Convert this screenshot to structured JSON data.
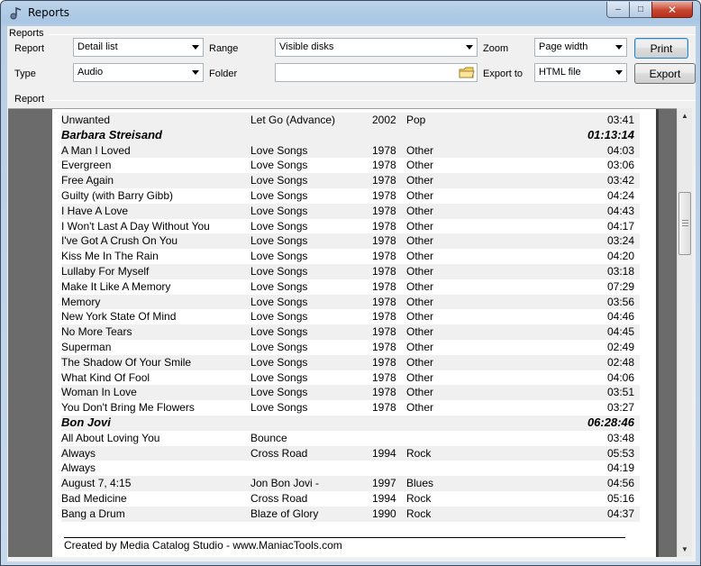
{
  "window": {
    "title": "Reports",
    "minimize_glyph": "–",
    "maximize_glyph": "□",
    "close_glyph": "✕"
  },
  "reports_group": {
    "label": "Reports",
    "report_label": "Report",
    "report_value": "Detail list",
    "type_label": "Type",
    "type_value": "Audio",
    "range_label": "Range",
    "range_value": "Visible disks",
    "folder_label": "Folder",
    "folder_value": "",
    "zoom_label": "Zoom",
    "zoom_value": "Page width",
    "export_to_label": "Export to",
    "export_to_value": "HTML file",
    "print_button": "Print",
    "export_button": "Export"
  },
  "report_group": {
    "label": "Report"
  },
  "report": {
    "rows": [
      {
        "kind": "track",
        "title": "Unwanted",
        "album": "Let Go (Advance)",
        "year": "2002",
        "genre": "Pop",
        "length": "03:41"
      },
      {
        "kind": "group",
        "title": "Barbara Streisand",
        "length": "01:13:14"
      },
      {
        "kind": "track",
        "title": "A Man I Loved",
        "album": "Love Songs",
        "year": "1978",
        "genre": "Other",
        "length": "04:03"
      },
      {
        "kind": "track",
        "title": "Evergreen",
        "album": "Love Songs",
        "year": "1978",
        "genre": "Other",
        "length": "03:06"
      },
      {
        "kind": "track",
        "title": "Free Again",
        "album": "Love Songs",
        "year": "1978",
        "genre": "Other",
        "length": "03:42"
      },
      {
        "kind": "track",
        "title": "Guilty (with Barry Gibb)",
        "album": "Love Songs",
        "year": "1978",
        "genre": "Other",
        "length": "04:24"
      },
      {
        "kind": "track",
        "title": "I Have A Love",
        "album": "Love Songs",
        "year": "1978",
        "genre": "Other",
        "length": "04:43"
      },
      {
        "kind": "track",
        "title": "I Won't Last A Day Without You",
        "album": "Love Songs",
        "year": "1978",
        "genre": "Other",
        "length": "04:17"
      },
      {
        "kind": "track",
        "title": "I've Got A Crush On You",
        "album": "Love Songs",
        "year": "1978",
        "genre": "Other",
        "length": "03:24"
      },
      {
        "kind": "track",
        "title": "Kiss Me In The Rain",
        "album": "Love Songs",
        "year": "1978",
        "genre": "Other",
        "length": "04:20"
      },
      {
        "kind": "track",
        "title": "Lullaby For Myself",
        "album": "Love Songs",
        "year": "1978",
        "genre": "Other",
        "length": "03:18"
      },
      {
        "kind": "track",
        "title": "Make It Like A Memory",
        "album": "Love Songs",
        "year": "1978",
        "genre": "Other",
        "length": "07:29"
      },
      {
        "kind": "track",
        "title": "Memory",
        "album": "Love Songs",
        "year": "1978",
        "genre": "Other",
        "length": "03:56"
      },
      {
        "kind": "track",
        "title": "New York State Of Mind",
        "album": "Love Songs",
        "year": "1978",
        "genre": "Other",
        "length": "04:46"
      },
      {
        "kind": "track",
        "title": "No More Tears",
        "album": "Love Songs",
        "year": "1978",
        "genre": "Other",
        "length": "04:45"
      },
      {
        "kind": "track",
        "title": "Superman",
        "album": "Love Songs",
        "year": "1978",
        "genre": "Other",
        "length": "02:49"
      },
      {
        "kind": "track",
        "title": "The Shadow Of Your Smile",
        "album": "Love Songs",
        "year": "1978",
        "genre": "Other",
        "length": "02:48"
      },
      {
        "kind": "track",
        "title": "What Kind Of Fool",
        "album": "Love Songs",
        "year": "1978",
        "genre": "Other",
        "length": "04:06"
      },
      {
        "kind": "track",
        "title": "Woman In Love",
        "album": "Love Songs",
        "year": "1978",
        "genre": "Other",
        "length": "03:51"
      },
      {
        "kind": "track",
        "title": "You Don't Bring Me Flowers",
        "album": "Love Songs",
        "year": "1978",
        "genre": "Other",
        "length": "03:27"
      },
      {
        "kind": "group",
        "title": "Bon Jovi",
        "length": "06:28:46"
      },
      {
        "kind": "track",
        "title": "All About Loving You",
        "album": "Bounce",
        "year": "",
        "genre": "",
        "length": "03:48"
      },
      {
        "kind": "track",
        "title": "Always",
        "album": "Cross Road",
        "year": "1994",
        "genre": "Rock",
        "length": "05:53"
      },
      {
        "kind": "track",
        "title": "Always",
        "album": "",
        "year": "",
        "genre": "",
        "length": "04:19"
      },
      {
        "kind": "track",
        "title": "August 7, 4:15",
        "album": "Jon Bon Jovi -",
        "year": "1997",
        "genre": "Blues",
        "length": "04:56"
      },
      {
        "kind": "track",
        "title": "Bad Medicine",
        "album": "Cross Road",
        "year": "1994",
        "genre": "Rock",
        "length": "05:16"
      },
      {
        "kind": "track",
        "title": "Bang a Drum",
        "album": "Blaze of Glory",
        "year": "1990",
        "genre": "Rock",
        "length": "04:37"
      }
    ],
    "footer": "Created by Media Catalog Studio - www.ManiacTools.com"
  },
  "icons": {
    "app": "app-icon",
    "folder": "folder-icon",
    "dropdown": "chevron-down-icon"
  },
  "colors": {
    "alt_row": "#f0f0f0",
    "viewport_bg": "#6b6b6b",
    "window_frame": "#a9c6e3",
    "close_button": "#c7452f"
  }
}
